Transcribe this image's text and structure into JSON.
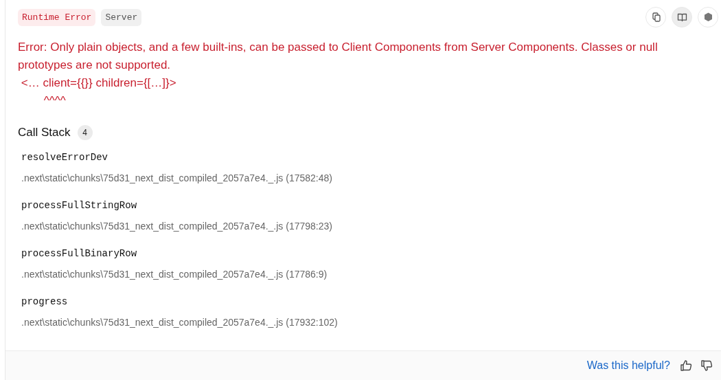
{
  "badges": [
    {
      "label": "Runtime Error",
      "kind": "error"
    },
    {
      "label": "Server",
      "kind": "neutral"
    }
  ],
  "toolbar": [
    {
      "kind": "copy",
      "selected": false
    },
    {
      "kind": "docs",
      "selected": true
    },
    {
      "kind": "nodejs",
      "selected": false
    }
  ],
  "error_message": "Error: Only plain objects, and a few built-ins, can be passed to Client Components from Server Components. Classes or null prototypes are not supported.\n <… client={{}} children={[…]}>\n        ^^^^",
  "call_stack": {
    "title": "Call Stack",
    "count": "4",
    "frames": [
      {
        "name": "resolveErrorDev",
        "location": ".next\\static\\chunks\\75d31_next_dist_compiled_2057a7e4._.js (17582:48)"
      },
      {
        "name": "processFullStringRow",
        "location": ".next\\static\\chunks\\75d31_next_dist_compiled_2057a7e4._.js (17798:23)"
      },
      {
        "name": "processFullBinaryRow",
        "location": ".next\\static\\chunks\\75d31_next_dist_compiled_2057a7e4._.js (17786:9)"
      },
      {
        "name": "progress",
        "location": ".next\\static\\chunks\\75d31_next_dist_compiled_2057a7e4._.js (17932:102)"
      }
    ]
  },
  "footer": {
    "question": "Was this helpful?"
  }
}
